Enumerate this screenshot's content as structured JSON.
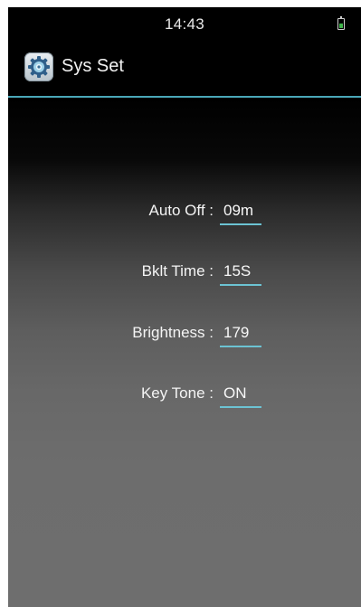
{
  "status_bar": {
    "time": "14:43",
    "battery_icon": "battery-icon",
    "battery_level": 0.6,
    "battery_color": "#3fb34a"
  },
  "header": {
    "title": "Sys Set",
    "icon": "gear-icon",
    "divider_color": "#4aa7b8"
  },
  "settings": [
    {
      "label": "Auto Off :",
      "value": "09m"
    },
    {
      "label": "Bklt Time :",
      "value": "15S"
    },
    {
      "label": "Brightness :",
      "value": "179"
    },
    {
      "label": "Key Tone :",
      "value": "ON"
    }
  ],
  "colors": {
    "underline": "#6cc3d3"
  }
}
